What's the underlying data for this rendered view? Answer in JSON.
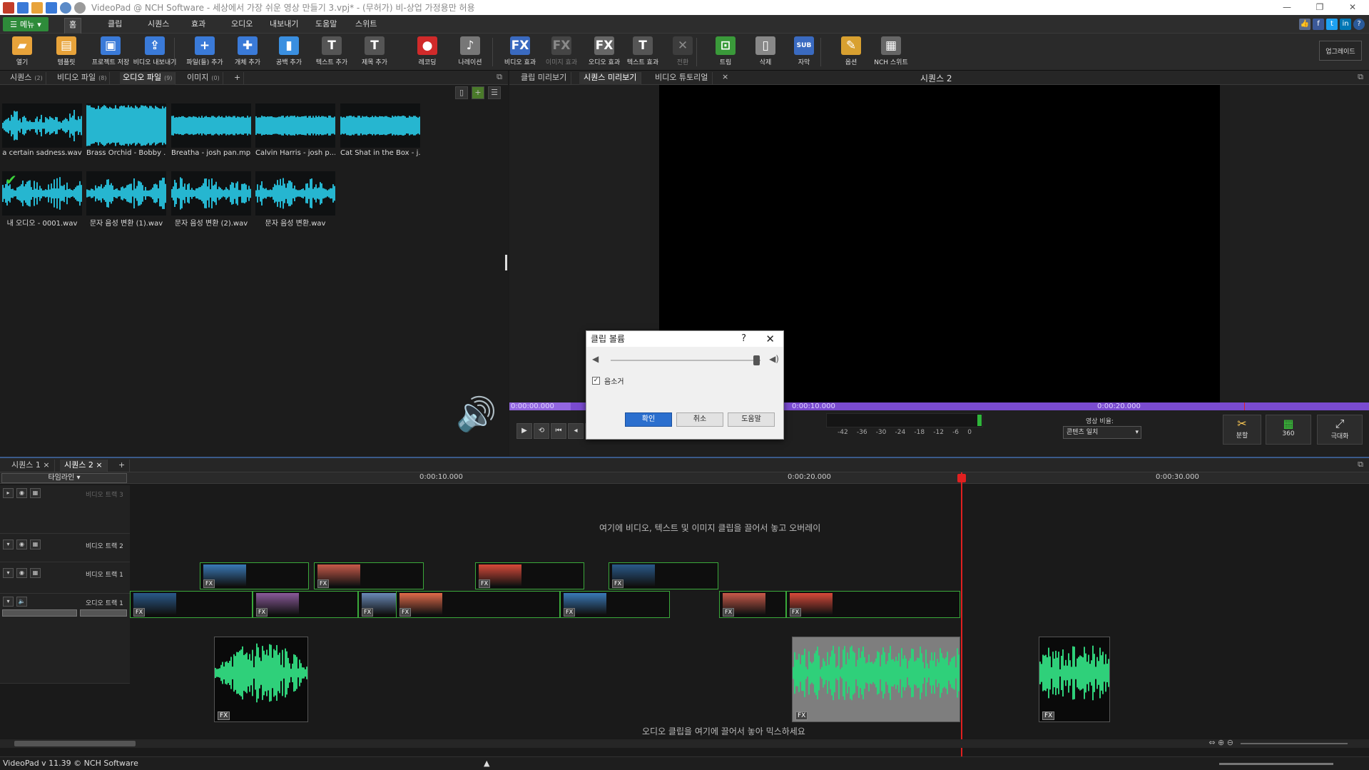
{
  "window": {
    "title": "VideoPad @ NCH Software - 세상에서 가장 쉬운 영상 만들기 3.vpj* - (무허가) 비-상업 가정용만 허용",
    "controls": [
      "—",
      "❐",
      "✕"
    ]
  },
  "menu": {
    "menu_button": "메뉴",
    "tabs": [
      "홈",
      "클립",
      "시퀀스",
      "효과",
      "오디오",
      "내보내기",
      "도움말",
      "스위트"
    ],
    "active_tab": "홈"
  },
  "toolbar": {
    "items": [
      {
        "label": "열기",
        "icon": "folder-open-icon",
        "color": "#e8a33a",
        "glyph": "▰"
      },
      {
        "label": "템플릿",
        "icon": "template-icon",
        "color": "#e8a33a",
        "glyph": "▤"
      },
      {
        "label": "프로젝트 저장",
        "icon": "save-icon",
        "color": "#3a7ad8",
        "glyph": "▣"
      },
      {
        "label": "비디오 내보내기",
        "icon": "export-video-icon",
        "color": "#3a7ad8",
        "glyph": "⇪"
      },
      {
        "label": "파일(들) 추가",
        "icon": "add-files-icon",
        "color": "#3a7ad8",
        "glyph": "+"
      },
      {
        "label": "개체 추가",
        "icon": "add-object-icon",
        "color": "#3a7ad8",
        "glyph": "✚"
      },
      {
        "label": "공백 추가",
        "icon": "add-blank-icon",
        "color": "#3a8fe0",
        "glyph": "▮"
      },
      {
        "label": "텍스트 추가",
        "icon": "add-text-icon",
        "color": "#555555",
        "glyph": "T"
      },
      {
        "label": "제목 추가",
        "icon": "add-title-icon",
        "color": "#555555",
        "glyph": "T"
      },
      {
        "label": "레코딩",
        "icon": "record-icon",
        "color": "#d02a2a",
        "glyph": "●"
      },
      {
        "label": "나레이션",
        "icon": "narration-mic-icon",
        "color": "#777777",
        "glyph": "♪"
      },
      {
        "label": "비디오 효과",
        "icon": "video-effects-icon",
        "color": "#3a6ac0",
        "glyph": "FX"
      },
      {
        "label": "이미지 효과",
        "icon": "image-effects-icon",
        "color": "#666666",
        "glyph": "FX"
      },
      {
        "label": "오디오 효과",
        "icon": "audio-effects-icon",
        "color": "#666666",
        "glyph": "FX"
      },
      {
        "label": "텍스트 효과",
        "icon": "text-effects-icon",
        "color": "#555555",
        "glyph": "T"
      },
      {
        "label": "전환",
        "icon": "transition-icon",
        "color": "#555555",
        "glyph": "✕"
      },
      {
        "label": "트림",
        "icon": "trim-icon",
        "color": "#3a9a3a",
        "glyph": "⊡"
      },
      {
        "label": "삭제",
        "icon": "delete-trash-icon",
        "color": "#888888",
        "glyph": "▯"
      },
      {
        "label": "자막",
        "icon": "subtitle-icon",
        "color": "#3a6ac0",
        "glyph": "SUB"
      },
      {
        "label": "옵션",
        "icon": "options-icon",
        "color": "#d8a030",
        "glyph": "✎"
      },
      {
        "label": "NCH 스위트",
        "icon": "nch-suite-icon",
        "color": "#666666",
        "glyph": "▦"
      }
    ],
    "upgrade": "업그레이드"
  },
  "bin": {
    "tabs": [
      {
        "label": "시퀀스",
        "count": "(2)"
      },
      {
        "label": "비디오 파일",
        "count": "(8)"
      },
      {
        "label": "오디오 파일",
        "count": "(9)"
      },
      {
        "label": "이미지",
        "count": "(0)"
      },
      {
        "label": "+",
        "count": ""
      }
    ],
    "active_tab": "오디오 파일",
    "files": [
      "a certain sadness.wav",
      "Brass Orchid - Bobby ...",
      "Breatha - josh pan.mp3",
      "Calvin Harris - josh p...",
      "Cat Shat in the Box - j...",
      "내 오디오 - 0001.wav",
      "문자 음성 변환 (1).wav",
      "문자 음성 변환 (2).wav",
      "문자 음성 변환.wav"
    ],
    "wave_color": "#26b6d0"
  },
  "preview": {
    "tabs": [
      "클립 미리보기",
      "시퀀스 미리보기",
      "비디오 튜토리얼"
    ],
    "active_tab": "시퀀스 미리보기",
    "sequence_title": "시퀀스 2",
    "times": [
      "0:00:00.000",
      "0:00:10.000",
      "0:00:20.000"
    ],
    "scrub_color": "#7a4bd0",
    "meter_labels": [
      "-42",
      "-36",
      "-30",
      "-24",
      "-18",
      "-12",
      "-6",
      "0"
    ],
    "ratio_label": "영상 비율:",
    "ratio_value": "콘텐츠 일치",
    "split": "분할",
    "vr": "360",
    "fullscreen": "극대화"
  },
  "dialog": {
    "title": "클립 볼륨",
    "help": "?",
    "close": "✕",
    "mute_label": "음소거",
    "mute_checked": true,
    "volume_level": 0.95,
    "ok": "확인",
    "cancel": "취소",
    "help_btn": "도움말"
  },
  "timeline": {
    "tabs": [
      "시퀀스 1 ×",
      "시퀀스 2 ×",
      "+"
    ],
    "active_tab": "시퀀스 2 ×",
    "mode": "타임라인",
    "ruler": [
      "0:00:10.000",
      "0:00:20.000",
      "0:00:30.000"
    ],
    "tracks": {
      "video3": "비디오 트랙 3",
      "video2": "비디오 트랙 2",
      "video1": "비디오 트랙 1",
      "audio1": "오디오 트랙 1"
    },
    "overlay_hint": "여기에 비디오, 텍스트 및 이미지 클립을 끌어서 놓고 오버레이",
    "audio_hint": "오디오 클립을 여기에 끌어서 놓아 믹스하세요",
    "audio_wave_color": "#2fd07a"
  },
  "status": "VideoPad v 11.39 © NCH Software"
}
